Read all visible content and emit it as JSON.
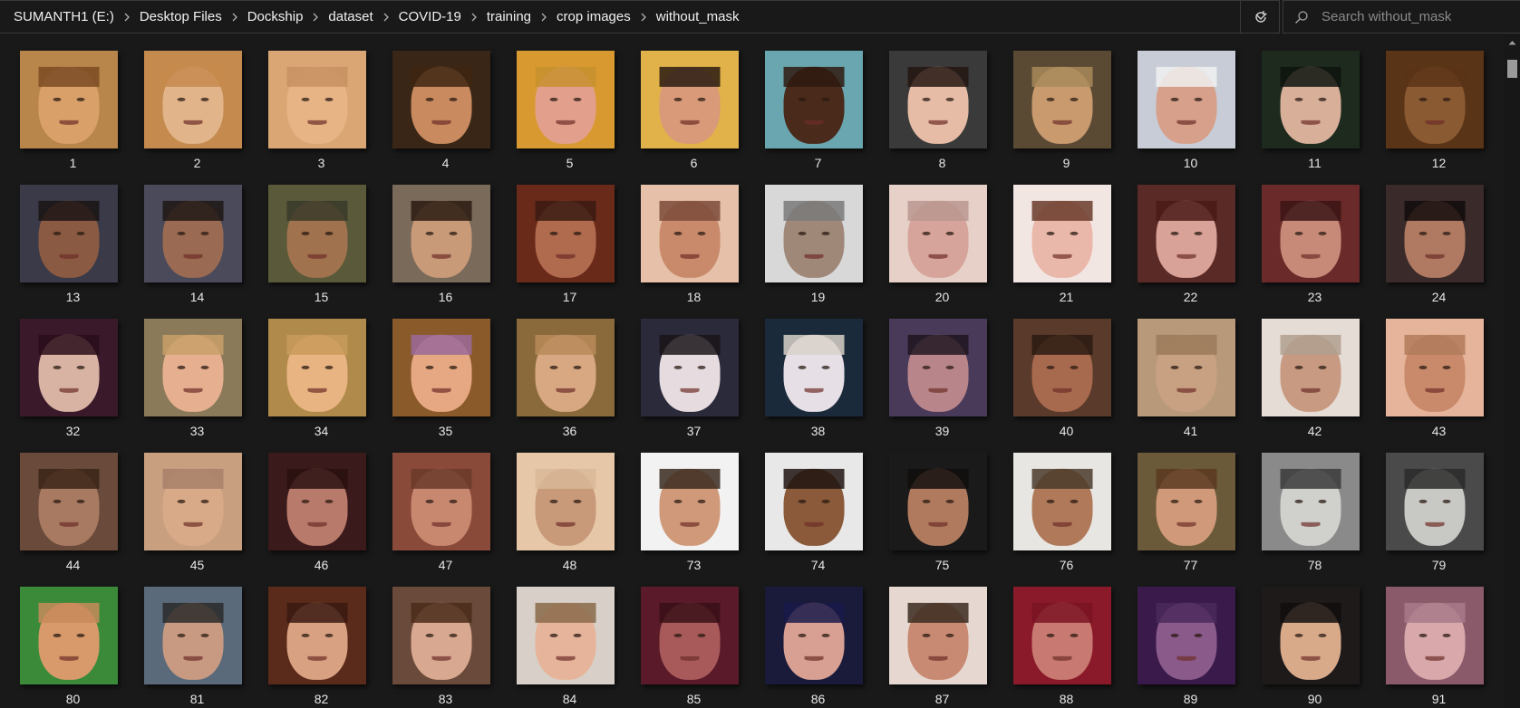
{
  "breadcrumbs": [
    "SUMANTH1 (E:)",
    "Desktop Files",
    "Dockship",
    "dataset",
    "COVID-19",
    "training",
    "crop images",
    "without_mask"
  ],
  "search": {
    "placeholder": "Search without_mask",
    "value": ""
  },
  "icons": {
    "separator": "chevron-right-icon",
    "dropdown": "chevron-down-icon",
    "refresh": "refresh-icon",
    "search": "search-icon",
    "scroll_up": "scroll-up-icon"
  },
  "colors": {
    "background": "#191919",
    "border": "#3a3a3a",
    "text": "#e6e6e6"
  },
  "files": [
    {
      "label": "1",
      "bg": "#b8864a",
      "skin": "#d9a06a",
      "hair": "#7a4a22"
    },
    {
      "label": "2",
      "bg": "#c58a4e",
      "skin": "#e2b48a",
      "hair": "#c58a4e"
    },
    {
      "label": "3",
      "bg": "#d9a674",
      "skin": "#e7b486",
      "hair": "#c89062"
    },
    {
      "label": "4",
      "bg": "#3a2616",
      "skin": "#c88a5e",
      "hair": "#3e2612"
    },
    {
      "label": "5",
      "bg": "#d89a30",
      "skin": "#e2a08c",
      "hair": "#c8902e"
    },
    {
      "label": "6",
      "bg": "#e2b24a",
      "skin": "#d89a78",
      "hair": "#2a1a12"
    },
    {
      "label": "7",
      "bg": "#6aa6b0",
      "skin": "#4a2a1a",
      "hair": "#2e1a10"
    },
    {
      "label": "8",
      "bg": "#3a3a3a",
      "skin": "#e6bca6",
      "hair": "#241612"
    },
    {
      "label": "9",
      "bg": "#5a4a34",
      "skin": "#c89a6e",
      "hair": "#a88a5a"
    },
    {
      "label": "10",
      "bg": "#c8ccd6",
      "skin": "#d6a08a",
      "hair": "#f0f0f0"
    },
    {
      "label": "11",
      "bg": "#1e2a1e",
      "skin": "#d8b09a",
      "hair": "#0e140e"
    },
    {
      "label": "12",
      "bg": "#5a3416",
      "skin": "#8a5a32",
      "hair": "#5a3416"
    },
    {
      "label": "13",
      "bg": "#3a3a48",
      "skin": "#8a5a42",
      "hair": "#1a1414"
    },
    {
      "label": "14",
      "bg": "#4a4a5a",
      "skin": "#9a6a52",
      "hair": "#1e1614"
    },
    {
      "label": "15",
      "bg": "#5a5a3a",
      "skin": "#a0724e",
      "hair": "#3a3a2a"
    },
    {
      "label": "16",
      "bg": "#7a6a5a",
      "skin": "#c89a78",
      "hair": "#2a1a12"
    },
    {
      "label": "17",
      "bg": "#6a2a1a",
      "skin": "#b06a4e",
      "hair": "#3a1a12"
    },
    {
      "label": "18",
      "bg": "#e6c0a8",
      "skin": "#c88a6a",
      "hair": "#7a4a3a"
    },
    {
      "label": "19",
      "bg": "#d8d8d8",
      "skin": "#a08878",
      "hair": "#7a7a7a"
    },
    {
      "label": "20",
      "bg": "#e6d0c8",
      "skin": "#d6a49a",
      "hair": "#b89890"
    },
    {
      "label": "21",
      "bg": "#f2e6e2",
      "skin": "#eab8aa",
      "hair": "#6a3a2a"
    },
    {
      "label": "22",
      "bg": "#5a2a26",
      "skin": "#d8a298",
      "hair": "#4a1a16"
    },
    {
      "label": "23",
      "bg": "#6a2a2a",
      "skin": "#c88a78",
      "hair": "#3a1414"
    },
    {
      "label": "24",
      "bg": "#3a2a2a",
      "skin": "#b07a62",
      "hair": "#120c0c"
    },
    {
      "label": "32",
      "bg": "#3a1a2a",
      "skin": "#d8b2a2",
      "hair": "#2a0e1a"
    },
    {
      "label": "33",
      "bg": "#8a7a5a",
      "skin": "#e6b090",
      "hair": "#c8a06a"
    },
    {
      "label": "34",
      "bg": "#b08a4a",
      "skin": "#e8b482",
      "hair": "#c89a5a"
    },
    {
      "label": "35",
      "bg": "#8a5a2a",
      "skin": "#e6a882",
      "hair": "#9a6a9a"
    },
    {
      "label": "36",
      "bg": "#8a6a3a",
      "skin": "#d8a882",
      "hair": "#b88a5a"
    },
    {
      "label": "37",
      "bg": "#2a2a3a",
      "skin": "#e6dce0",
      "hair": "#1a1418"
    },
    {
      "label": "38",
      "bg": "#1a2a3a",
      "skin": "#e6e0e6",
      "hair": "#d8d0c8"
    },
    {
      "label": "39",
      "bg": "#4a3a5a",
      "skin": "#b8868a",
      "hair": "#1e1620"
    },
    {
      "label": "40",
      "bg": "#5a3a2a",
      "skin": "#a86a4e",
      "hair": "#2a1a12"
    },
    {
      "label": "41",
      "bg": "#b89a7a",
      "skin": "#c8a082",
      "hair": "#9a7a5a"
    },
    {
      "label": "42",
      "bg": "#e6dcd6",
      "skin": "#c89a82",
      "hair": "#b0a090"
    },
    {
      "label": "43",
      "bg": "#e6b49a",
      "skin": "#c88a6a",
      "hair": "#b07a5a"
    },
    {
      "label": "44",
      "bg": "#6a4a3a",
      "skin": "#a87a62",
      "hair": "#3a2418"
    },
    {
      "label": "45",
      "bg": "#c8a080",
      "skin": "#d8aa88",
      "hair": "#a8806a"
    },
    {
      "label": "46",
      "bg": "#3a1a1a",
      "skin": "#b87a6a",
      "hair": "#2a1010"
    },
    {
      "label": "47",
      "bg": "#8a4a3a",
      "skin": "#c88870",
      "hair": "#6a3a2a"
    },
    {
      "label": "48",
      "bg": "#e6c8a8",
      "skin": "#c89a7a",
      "hair": "#d8b898"
    },
    {
      "label": "73",
      "bg": "#f2f2f2",
      "skin": "#d09a7a",
      "hair": "#3a2a20"
    },
    {
      "label": "74",
      "bg": "#e8e8e8",
      "skin": "#8a5a3a",
      "hair": "#1e1410"
    },
    {
      "label": "75",
      "bg": "#1a1a1a",
      "skin": "#b07a5e",
      "hair": "#120e0e"
    },
    {
      "label": "76",
      "bg": "#e8e6e2",
      "skin": "#b07a5a",
      "hair": "#4a3a2a"
    },
    {
      "label": "77",
      "bg": "#6a5a3a",
      "skin": "#d09a7a",
      "hair": "#5a3a22"
    },
    {
      "label": "78",
      "bg": "#8a8a8a",
      "skin": "#d0d0cc",
      "hair": "#3a3a3a"
    },
    {
      "label": "79",
      "bg": "#4a4a4a",
      "skin": "#c8c8c4",
      "hair": "#2a2a2a"
    },
    {
      "label": "80",
      "bg": "#3a8a3a",
      "skin": "#d89a6a",
      "hair": "#c88a5a"
    },
    {
      "label": "81",
      "bg": "#5a6a7a",
      "skin": "#c89a82",
      "hair": "#2a2a2a"
    },
    {
      "label": "82",
      "bg": "#5a2a1a",
      "skin": "#d8a282",
      "hair": "#3a1a10"
    },
    {
      "label": "83",
      "bg": "#6a4a3a",
      "skin": "#d8a890",
      "hair": "#4a2a1a"
    },
    {
      "label": "84",
      "bg": "#d8d0c8",
      "skin": "#e6b49a",
      "hair": "#8a6a4a"
    },
    {
      "label": "85",
      "bg": "#5a1a2a",
      "skin": "#a85a5a",
      "hair": "#3a1018"
    },
    {
      "label": "86",
      "bg": "#1a1a3a",
      "skin": "#d8a092",
      "hair": "#1a1a4a"
    },
    {
      "label": "87",
      "bg": "#e6d8d0",
      "skin": "#c88a72",
      "hair": "#3a2a20"
    },
    {
      "label": "88",
      "bg": "#8a1a2a",
      "skin": "#c87a72",
      "hair": "#7a1422"
    },
    {
      "label": "89",
      "bg": "#3a1a4a",
      "skin": "#8a5a8a",
      "hair": "#4a2a5a"
    },
    {
      "label": "90",
      "bg": "#1e1a1a",
      "skin": "#d8aa8a",
      "hair": "#120e0e"
    },
    {
      "label": "91",
      "bg": "#8a5a6a",
      "skin": "#d8a8aa",
      "hair": "#a87a8a"
    }
  ]
}
